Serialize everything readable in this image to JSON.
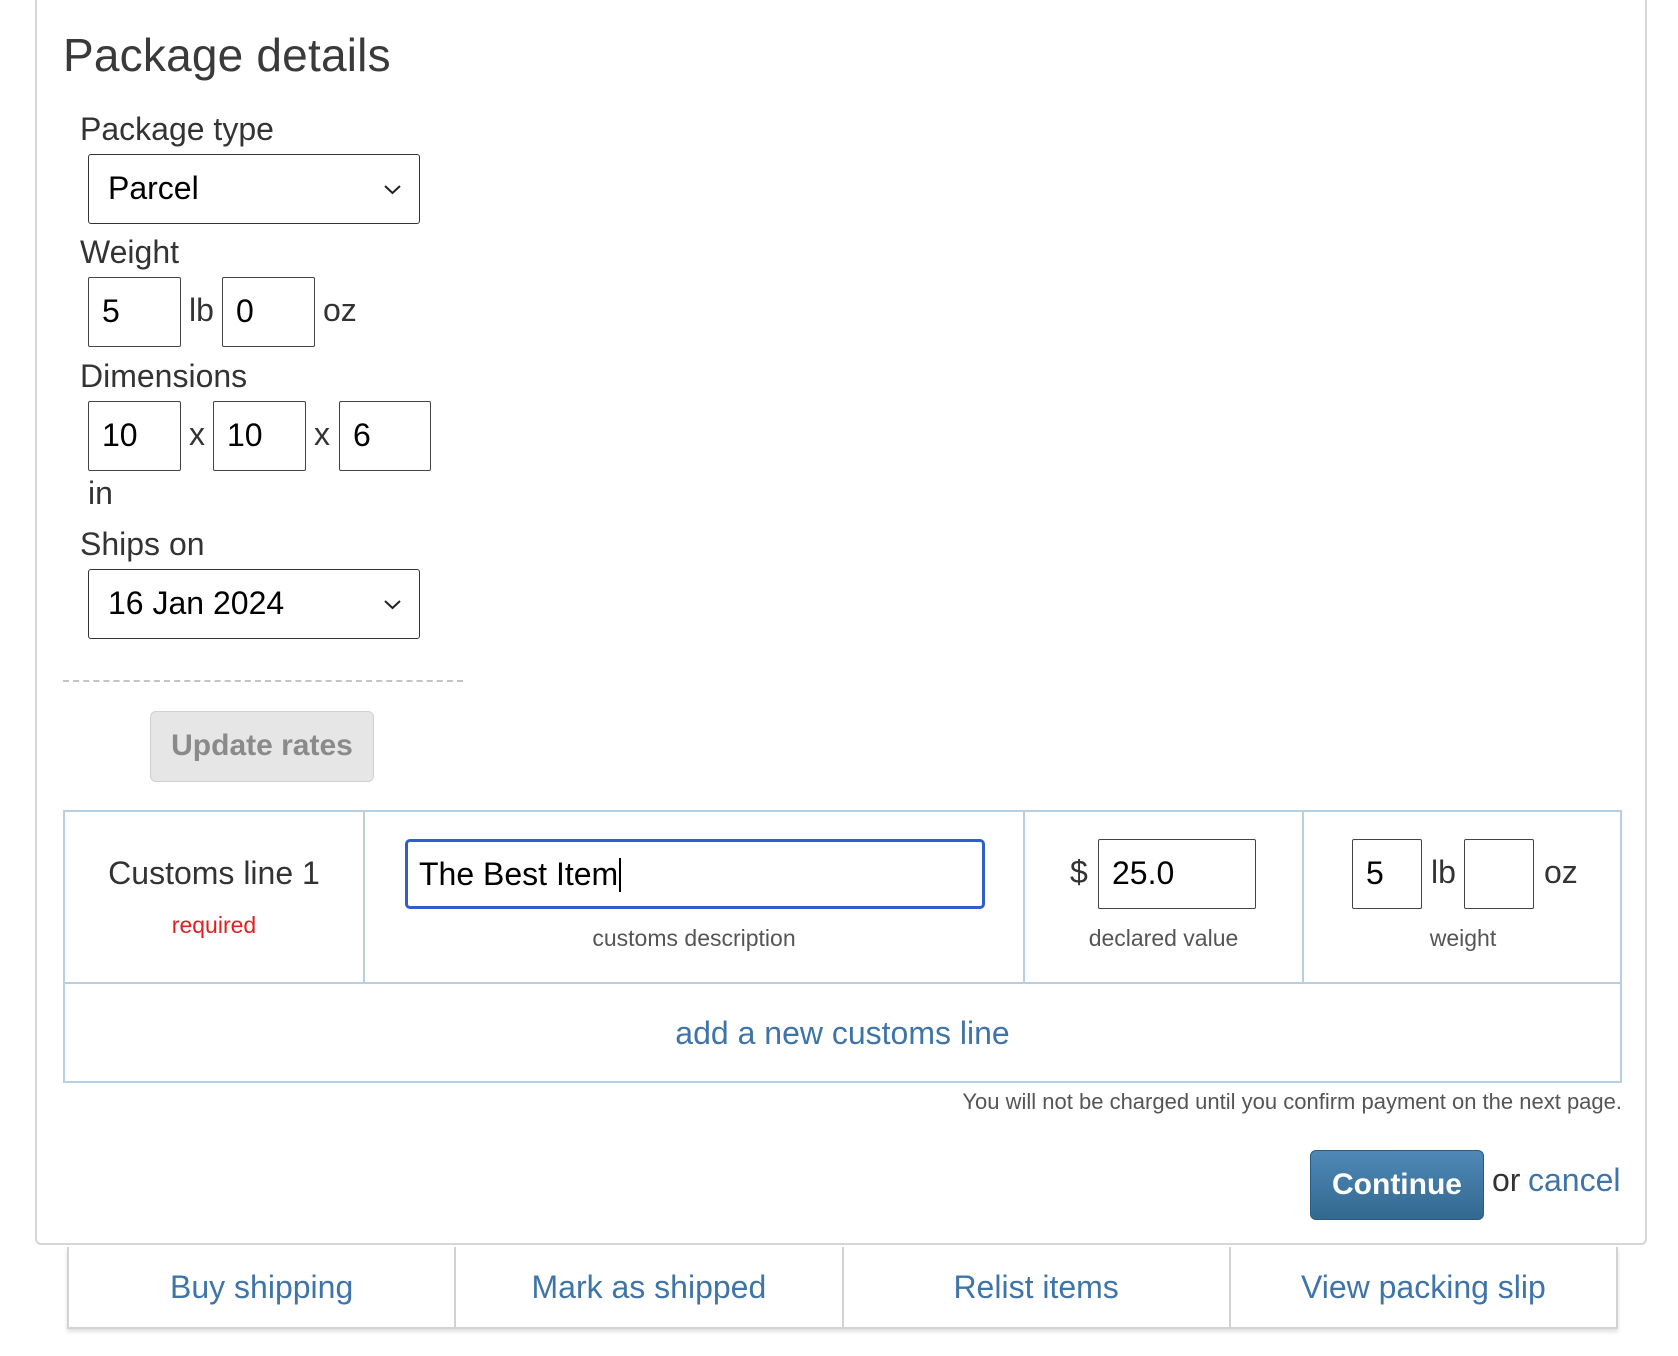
{
  "title": "Package details",
  "package_type": {
    "label": "Package type",
    "value": "Parcel"
  },
  "weight": {
    "label": "Weight",
    "lb_value": "5",
    "lb_unit": "lb",
    "oz_value": "0",
    "oz_unit": "oz"
  },
  "dimensions": {
    "label": "Dimensions",
    "length": "10",
    "width": "10",
    "height": "6",
    "separator": "x",
    "unit": "in"
  },
  "ships_on": {
    "label": "Ships on",
    "value": "16 Jan 2024"
  },
  "update_rates_label": "Update rates",
  "customs": {
    "line_title": "Customs line 1",
    "required_text": "required",
    "description_value": "The Best Item",
    "description_caption": "customs description",
    "currency_symbol": "$",
    "declared_value": "25.0",
    "declared_caption": "declared value",
    "weight_lb_value": "5",
    "weight_lb_unit": "lb",
    "weight_oz_value": "",
    "weight_oz_unit": "oz",
    "weight_caption": "weight",
    "add_line_label": "add a new customs line"
  },
  "notice": "You will not be charged until you confirm payment on the next page.",
  "continue_label": "Continue",
  "or_text": "or",
  "cancel_label": "cancel",
  "tabs": [
    {
      "label": "Buy shipping"
    },
    {
      "label": "Mark as shipped"
    },
    {
      "label": "Relist items"
    },
    {
      "label": "View packing slip"
    }
  ],
  "colors": {
    "link": "#3f74a8",
    "required": "#e02020",
    "focus_border": "#2d5ec9",
    "table_border": "#b7cfe2",
    "continue_button": "#3d76a3"
  }
}
